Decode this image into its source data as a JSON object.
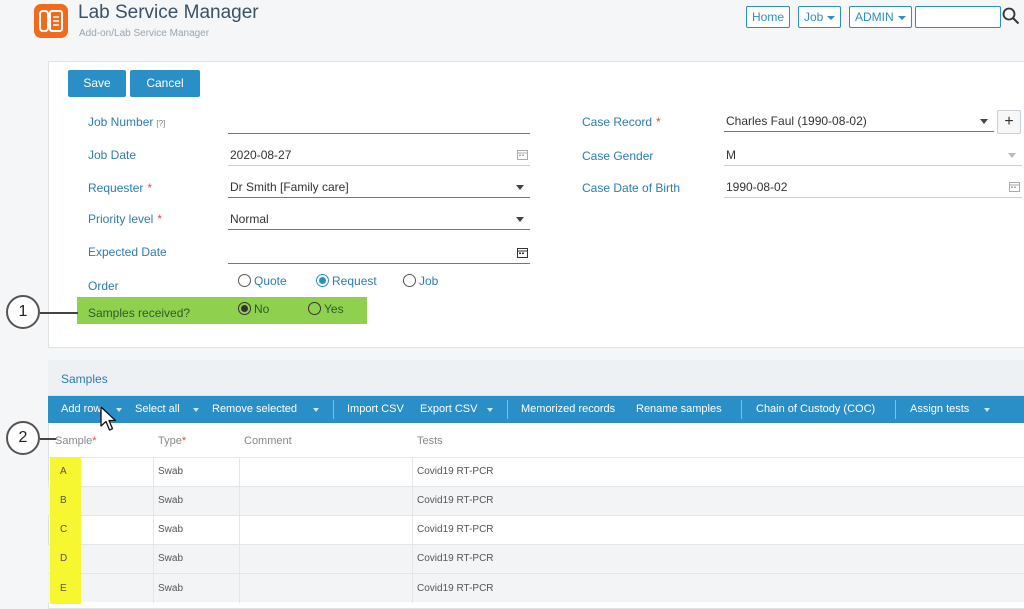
{
  "header": {
    "title": "Lab Service Manager",
    "subtitle": "Add-on/Lab Service Manager",
    "nav": {
      "home": "Home",
      "job": "Job",
      "admin": "ADMIN"
    },
    "search_value": ""
  },
  "form": {
    "save_label": "Save",
    "cancel_label": "Cancel",
    "job_number": {
      "label": "Job Number",
      "hint": "[?]",
      "value": ""
    },
    "job_date": {
      "label": "Job Date",
      "value": "2020-08-27"
    },
    "requester": {
      "label": "Requester",
      "required": "*",
      "value": "Dr Smith [Family care]"
    },
    "priority": {
      "label": "Priority level",
      "required": "*",
      "value": "Normal"
    },
    "expected_date": {
      "label": "Expected Date",
      "value": ""
    },
    "order": {
      "label": "Order",
      "options": [
        "Quote",
        "Request",
        "Job"
      ],
      "selected": "Request"
    },
    "samples_received": {
      "label": "Samples received?",
      "options": [
        "No",
        "Yes"
      ],
      "selected": "No"
    },
    "case_record": {
      "label": "Case Record",
      "required": "*",
      "value": "Charles Faul (1990-08-02)",
      "add": "+"
    },
    "case_gender": {
      "label": "Case Gender",
      "value": "M"
    },
    "case_dob": {
      "label": "Case Date of Birth",
      "value": "1990-08-02"
    }
  },
  "callouts": {
    "one": "1",
    "two": "2"
  },
  "samples": {
    "title": "Samples",
    "toolbar": {
      "add_row": "Add row",
      "select_all": "Select all",
      "remove_selected": "Remove selected",
      "import_csv": "Import CSV",
      "export_csv": "Export CSV",
      "memorized": "Memorized records",
      "rename": "Rename samples",
      "coc": "Chain of Custody (COC)",
      "assign_tests": "Assign tests"
    },
    "columns": {
      "sample": "Sample",
      "sample_req": "*",
      "type": "Type",
      "type_req": "*",
      "comment": "Comment",
      "tests": "Tests"
    },
    "rows": [
      {
        "id": "A",
        "type": "Swab",
        "comment": "",
        "tests": "Covid19 RT-PCR"
      },
      {
        "id": "B",
        "type": "Swab",
        "comment": "",
        "tests": "Covid19 RT-PCR"
      },
      {
        "id": "C",
        "type": "Swab",
        "comment": "",
        "tests": "Covid19 RT-PCR"
      },
      {
        "id": "D",
        "type": "Swab",
        "comment": "",
        "tests": "Covid19 RT-PCR"
      },
      {
        "id": "E",
        "type": "Swab",
        "comment": "",
        "tests": "Covid19 RT-PCR"
      }
    ]
  },
  "colors": {
    "accent": "#2a8fc6",
    "logo": "#f26b1d",
    "highlight_green": "#8fd14f",
    "highlight_yellow": "#f6f631",
    "required": "#e14b4b"
  }
}
